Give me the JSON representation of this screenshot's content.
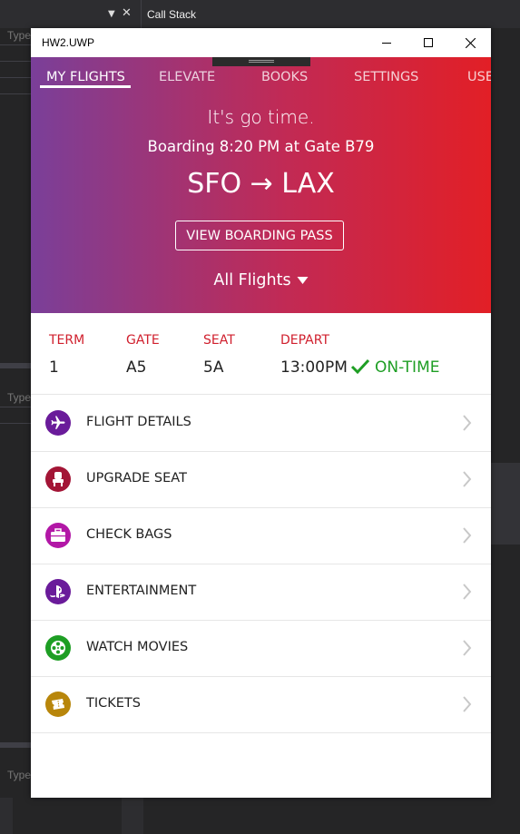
{
  "ide": {
    "callstack_label": "Call Stack",
    "type_label": "Type"
  },
  "window": {
    "title": "HW2.UWP"
  },
  "tabs": [
    {
      "label": "MY FLIGHTS"
    },
    {
      "label": "ELEVATE"
    },
    {
      "label": "BOOKS"
    },
    {
      "label": "SETTINGS"
    },
    {
      "label": "USE"
    }
  ],
  "hero": {
    "tagline": "It's go time.",
    "boarding": "Boarding 8:20 PM at Gate B79",
    "route": "SFO → LAX",
    "pass_button": "VIEW BOARDING PASS",
    "all_flights": "All Flights"
  },
  "info": {
    "term_label": "TERM",
    "term_value": "1",
    "gate_label": "GATE",
    "gate_value": "A5",
    "seat_label": "SEAT",
    "seat_value": "5A",
    "depart_label": "DEPART",
    "depart_value": "13:00PM",
    "status": "ON-TIME"
  },
  "menu": [
    {
      "label": "FLIGHT DETAILS",
      "icon": "airplane-icon",
      "color": "#6a1b9a"
    },
    {
      "label": "UPGRADE SEAT",
      "icon": "seat-icon",
      "color": "#a31536"
    },
    {
      "label": "CHECK BAGS",
      "icon": "briefcase-icon",
      "color": "#b217a6"
    },
    {
      "label": "ENTERTAINMENT",
      "icon": "playstation-icon",
      "color": "#6a1b9a"
    },
    {
      "label": "WATCH MOVIES",
      "icon": "film-reel-icon",
      "color": "#1e9e24"
    },
    {
      "label": "TICKETS",
      "icon": "ticket-icon",
      "color": "#b8860b"
    }
  ],
  "colors": {
    "gradient_start": "#7a3f99",
    "gradient_end": "#e21f26",
    "label_red": "#d0202e",
    "status_green": "#1e9e24"
  }
}
